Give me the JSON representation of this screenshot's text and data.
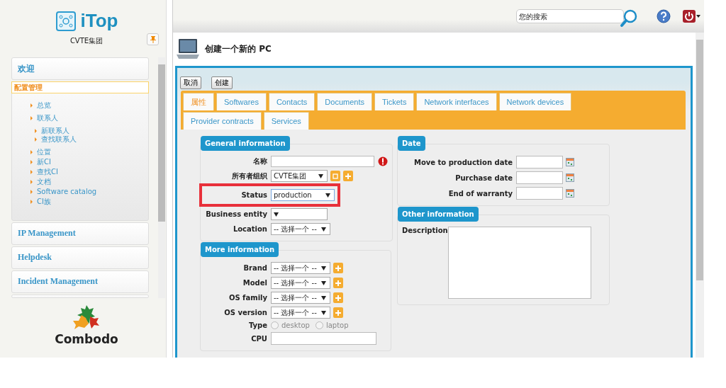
{
  "sidebar": {
    "logo_text": "iTop",
    "organization": "CVTE集团",
    "menu": [
      {
        "label": "欢迎",
        "expanded": false,
        "selected": false
      },
      {
        "label": "配置管理",
        "expanded": true,
        "selected": true,
        "items": [
          {
            "label": "总览"
          },
          {
            "label": "联系人",
            "children": [
              {
                "label": "新联系人"
              },
              {
                "label": "查找联系人"
              }
            ]
          },
          {
            "label": "位置"
          },
          {
            "label": "新CI"
          },
          {
            "label": "查找CI"
          },
          {
            "label": "文档"
          },
          {
            "label": "Software catalog"
          },
          {
            "label": "CI族"
          }
        ]
      },
      {
        "label": "IP Management",
        "expanded": false,
        "selected": false
      },
      {
        "label": "Helpdesk",
        "expanded": false,
        "selected": false
      },
      {
        "label": "Incident Management",
        "expanded": false,
        "selected": false
      }
    ],
    "footer_logo_text": "Combodo"
  },
  "header": {
    "search": {
      "placeholder": "您的搜索"
    }
  },
  "page": {
    "title": "创建一个新的 PC",
    "buttons": [
      "取消",
      "创建"
    ],
    "tabs": [
      {
        "label": "属性",
        "selected": true
      },
      {
        "label": "Softwares",
        "selected": false
      },
      {
        "label": "Contacts",
        "selected": false
      },
      {
        "label": "Documents",
        "selected": false
      },
      {
        "label": "Tickets",
        "selected": false
      },
      {
        "label": "Network interfaces",
        "selected": false
      },
      {
        "label": "Network devices",
        "selected": false
      },
      {
        "label": "Provider contracts",
        "selected": false
      },
      {
        "label": "Services",
        "selected": false
      }
    ],
    "columns": [
      [
        {
          "title": "General information",
          "fields": [
            {
              "label": "名称",
              "kind": "text",
              "required": true
            },
            {
              "label": "所有者组织",
              "kind": "select",
              "value": "CVTE集团",
              "actions": [
                {
                  "kind": "details"
                },
                {
                  "kind": "add"
                }
              ]
            },
            {
              "label": "Status",
              "kind": "select",
              "value": "production",
              "highlighted": true
            },
            {
              "label": "Business entity",
              "kind": "select"
            },
            {
              "label": "Location",
              "kind": "select",
              "value": "-- 选择一个 --"
            }
          ]
        },
        {
          "title": "More information",
          "fields": [
            {
              "label": "Brand",
              "kind": "select",
              "value": "-- 选择一个 --",
              "actions": [
                {
                  "kind": "add"
                }
              ]
            },
            {
              "label": "Model",
              "kind": "select",
              "value": "-- 选择一个 --",
              "actions": [
                {
                  "kind": "add"
                }
              ]
            },
            {
              "label": "OS family",
              "kind": "select",
              "value": "-- 选择一个 --",
              "actions": [
                {
                  "kind": "add"
                }
              ]
            },
            {
              "label": "OS version",
              "kind": "select",
              "value": "-- 选择一个 --",
              "actions": [
                {
                  "kind": "add"
                }
              ]
            },
            {
              "label": "Type",
              "kind": "radio",
              "options": [
                {
                  "label": "desktop",
                  "selected": false
                },
                {
                  "label": "laptop",
                  "selected": false
                }
              ]
            },
            {
              "label": "CPU",
              "kind": "text"
            }
          ]
        }
      ],
      [
        {
          "title": "Date",
          "fields": [
            {
              "label": "Move to production date",
              "kind": "date"
            },
            {
              "label": "Purchase date",
              "kind": "date"
            },
            {
              "label": "End of warranty",
              "kind": "date"
            }
          ]
        },
        {
          "title": "Other information",
          "fields": [
            {
              "label": "Description",
              "kind": "textarea"
            }
          ]
        }
      ]
    ]
  }
}
